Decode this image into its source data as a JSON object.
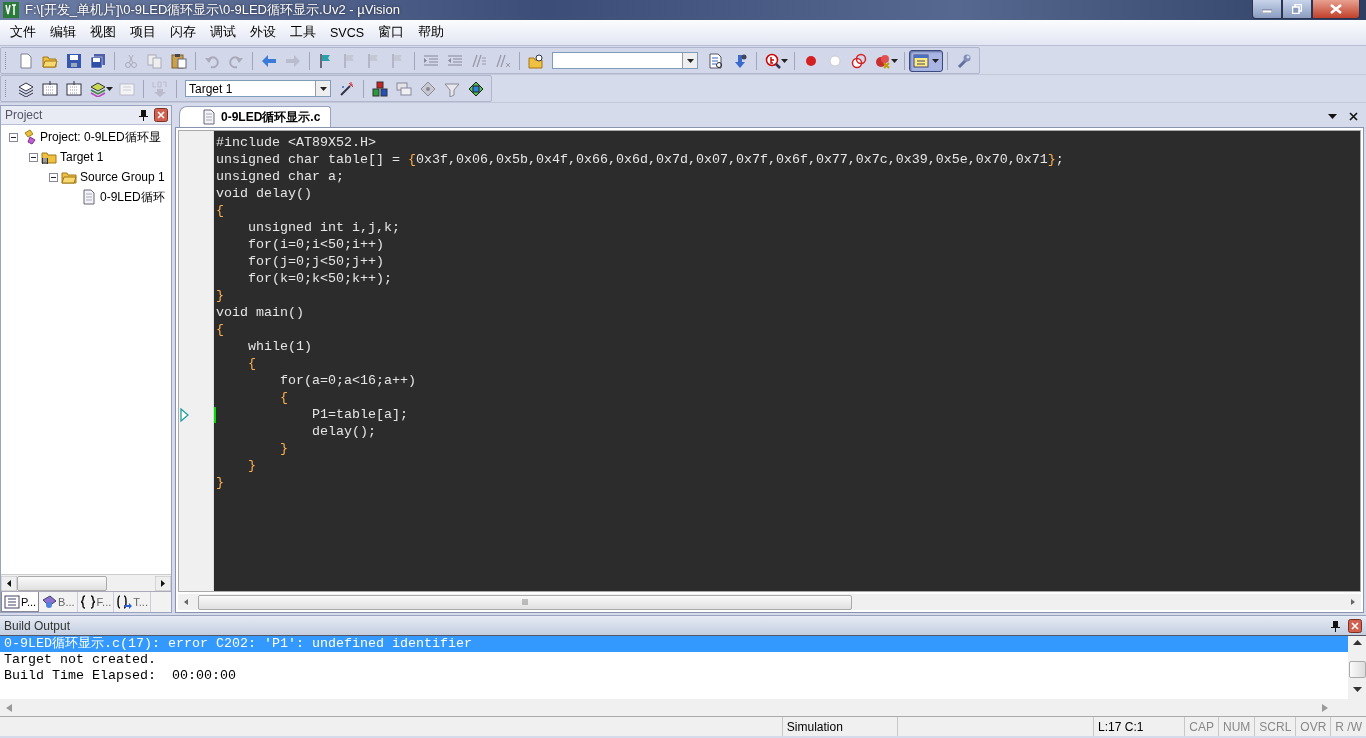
{
  "window": {
    "title": "F:\\[开发_单机片]\\0-9LED循环显示\\0-9LED循环显示.Uv2 - µVision"
  },
  "menu": [
    "文件",
    "编辑",
    "视图",
    "项目",
    "闪存",
    "调试",
    "外设",
    "工具",
    "SVCS",
    "窗口",
    "帮助"
  ],
  "toolbar": {
    "window_button": {
      "pressed": true
    },
    "target": "Target 1"
  },
  "project_panel": {
    "title": "Project",
    "tree": [
      {
        "label": "Project: 0-9LED循环显",
        "kind": "project",
        "expanded": true,
        "children": [
          {
            "label": "Target 1",
            "kind": "target",
            "expanded": true,
            "children": [
              {
                "label": "Source Group 1",
                "kind": "group",
                "expanded": true,
                "children": [
                  {
                    "label": "0-9LED循环",
                    "kind": "file"
                  }
                ]
              }
            ]
          }
        ]
      }
    ],
    "tabs": [
      {
        "label": "P...",
        "kind": "files",
        "selected": true
      },
      {
        "label": "B...",
        "kind": "books",
        "selected": false
      },
      {
        "label": "F...",
        "kind": "functions",
        "selected": false
      },
      {
        "label": "T...",
        "kind": "templates",
        "selected": false
      }
    ]
  },
  "editor": {
    "tab": {
      "label": "0-9LED循环显示.c",
      "selected": true
    },
    "lines": [
      {
        "text": "#include <AT89X52.H>",
        "current": false
      },
      {
        "text": "unsigned char table[] = {0x3f,0x06,0x5b,0x4f,0x66,0x6d,0x7d,0x07,0x7f,0x6f,0x77,0x7c,0x39,0x5e,0x70,0x71};",
        "current": false
      },
      {
        "text": "unsigned char a;",
        "current": false
      },
      {
        "text": "void delay()",
        "current": false
      },
      {
        "text": "{",
        "current": false
      },
      {
        "text": "    unsigned int i,j,k;",
        "current": false
      },
      {
        "text": "    for(i=0;i<50;i++)",
        "current": false
      },
      {
        "text": "    for(j=0;j<50;j++)",
        "current": false
      },
      {
        "text": "    for(k=0;k<50;k++);",
        "current": false
      },
      {
        "text": "}",
        "current": false
      },
      {
        "text": "void main()",
        "current": false
      },
      {
        "text": "{",
        "current": false
      },
      {
        "text": "    while(1)",
        "current": false
      },
      {
        "text": "    {",
        "current": false
      },
      {
        "text": "        for(a=0;a<16;a++)",
        "current": false
      },
      {
        "text": "        {",
        "current": false
      },
      {
        "text": "            P1=table[a];",
        "current": true
      },
      {
        "text": "            delay();",
        "current": false
      },
      {
        "text": "        }",
        "current": false
      },
      {
        "text": "    }",
        "current": false
      },
      {
        "text": "}",
        "current": false
      }
    ]
  },
  "build_output": {
    "title": "Build Output",
    "lines": [
      {
        "text": "0-9LED循环显示.c(17): error C202: 'P1': undefined identifier",
        "selected": true
      },
      {
        "text": "Target not created.",
        "selected": false
      },
      {
        "text": "Build Time Elapsed:  00:00:00",
        "selected": false
      }
    ]
  },
  "status_bar": {
    "mode": "Simulation",
    "position": "L:17 C:1",
    "indicators": [
      {
        "label": "CAP",
        "on": false
      },
      {
        "label": "NUM",
        "on": false
      },
      {
        "label": "SCRL",
        "on": false
      },
      {
        "label": "OVR",
        "on": false
      },
      {
        "label": "R /W",
        "on": false
      }
    ]
  }
}
